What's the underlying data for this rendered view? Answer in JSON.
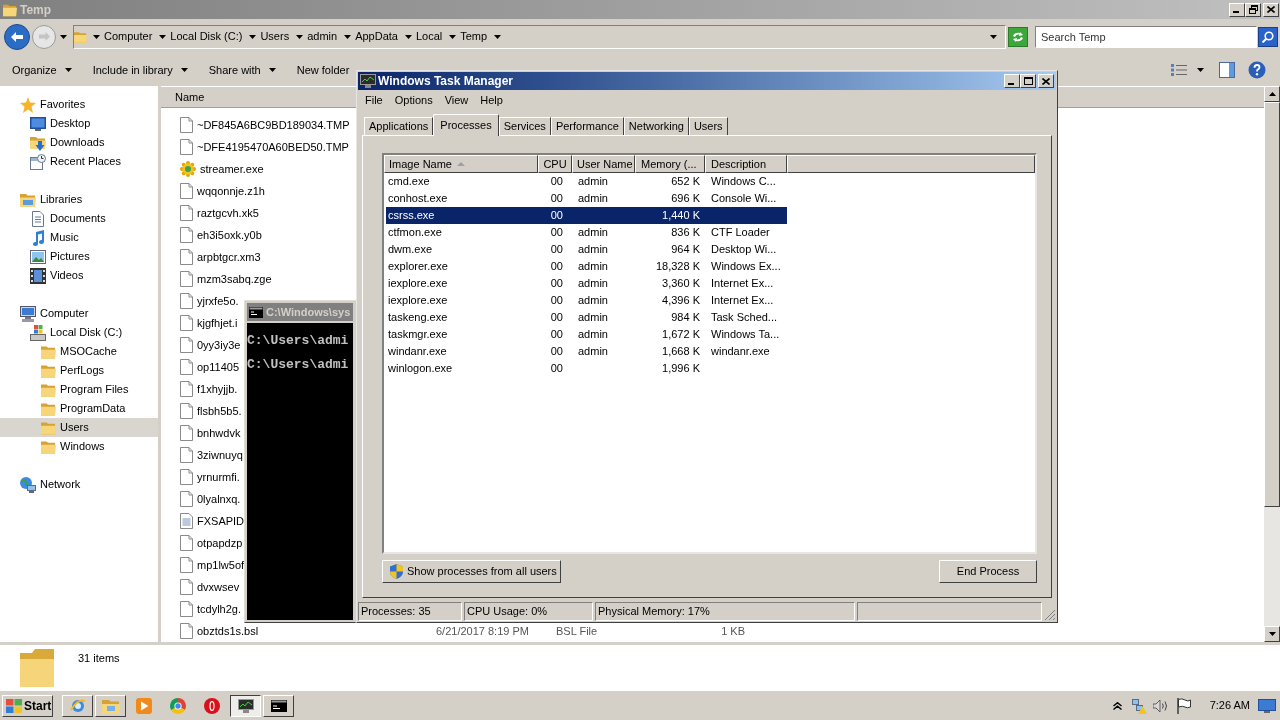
{
  "explorer": {
    "title": "Temp",
    "breadcrumb": [
      "Computer",
      "Local Disk (C:)",
      "Users",
      "admin",
      "AppData",
      "Local",
      "Temp"
    ],
    "search": {
      "placeholder": "Search Temp"
    },
    "toolbar": [
      {
        "label": "Organize",
        "kind": "menu"
      },
      {
        "label": "Include in library",
        "kind": "menu"
      },
      {
        "label": "Share with",
        "kind": "menu"
      },
      {
        "label": "New folder",
        "kind": "button"
      }
    ],
    "nav": [
      {
        "label": "Favorites",
        "selected": false,
        "children": [
          {
            "label": "Desktop",
            "selected": false
          },
          {
            "label": "Downloads",
            "selected": false
          },
          {
            "label": "Recent Places",
            "selected": false
          }
        ]
      },
      {
        "label": "Libraries",
        "selected": false,
        "children": [
          {
            "label": "Documents",
            "selected": false
          },
          {
            "label": "Music",
            "selected": false
          },
          {
            "label": "Pictures",
            "selected": false
          },
          {
            "label": "Videos",
            "selected": false
          }
        ]
      },
      {
        "label": "Computer",
        "selected": false,
        "children": [
          {
            "label": "Local Disk (C:)",
            "selected": false,
            "children": [
              {
                "label": "MSOCache",
                "selected": false
              },
              {
                "label": "PerfLogs",
                "selected": false
              },
              {
                "label": "Program Files",
                "selected": false
              },
              {
                "label": "ProgramData",
                "selected": false
              },
              {
                "label": "Users",
                "selected": true
              },
              {
                "label": "Windows",
                "selected": false
              }
            ]
          }
        ]
      },
      {
        "label": "Network",
        "selected": false
      }
    ],
    "columns": [
      "Name"
    ],
    "files": [
      {
        "name": "~DF845A6BC9BD189034.TMP",
        "kind": "file"
      },
      {
        "name": "~DFE4195470A60BED50.TMP",
        "kind": "file"
      },
      {
        "name": "streamer.exe",
        "kind": "exe"
      },
      {
        "name": "wqqonnje.z1h",
        "kind": "file"
      },
      {
        "name": "raztgcvh.xk5",
        "kind": "file"
      },
      {
        "name": "eh3i5oxk.y0b",
        "kind": "file"
      },
      {
        "name": "arpbtgcr.xm3",
        "kind": "file"
      },
      {
        "name": "mzm3sabq.zge",
        "kind": "file"
      },
      {
        "name": "yjrxfe5o.",
        "kind": "file"
      },
      {
        "name": "kjgfhjet.i",
        "kind": "file"
      },
      {
        "name": "0yy3iy3e",
        "kind": "file"
      },
      {
        "name": "op11405",
        "kind": "file"
      },
      {
        "name": "f1xhyjjb.",
        "kind": "file"
      },
      {
        "name": "flsbh5b5.",
        "kind": "file"
      },
      {
        "name": "bnhwdvk",
        "kind": "file"
      },
      {
        "name": "3ziwnuyq",
        "kind": "file"
      },
      {
        "name": "yrnurmfi.",
        "kind": "file"
      },
      {
        "name": "0lyalnxq.",
        "kind": "file"
      },
      {
        "name": "FXSAPID",
        "kind": "text"
      },
      {
        "name": "otpapdzp",
        "kind": "file"
      },
      {
        "name": "mp1lw5of",
        "kind": "file"
      },
      {
        "name": "dvxwsev",
        "kind": "file"
      },
      {
        "name": "tcdylh2g.",
        "kind": "file"
      },
      {
        "name": "obztds1s.bsl",
        "kind": "file",
        "date": "6/21/2017 8:19 PM",
        "type": "BSL File",
        "size": "1 KB"
      }
    ],
    "status": "31 items"
  },
  "cmd": {
    "title": "C:\\Windows\\sys",
    "lines": [
      "C:\\Users\\admi",
      "C:\\Users\\admi"
    ]
  },
  "task_manager": {
    "title": "Windows Task Manager",
    "menu": [
      "File",
      "Options",
      "View",
      "Help"
    ],
    "tabs": [
      {
        "label": "Applications",
        "selected": false
      },
      {
        "label": "Processes",
        "selected": true
      },
      {
        "label": "Services",
        "selected": false
      },
      {
        "label": "Performance",
        "selected": false
      },
      {
        "label": "Networking",
        "selected": false
      },
      {
        "label": "Users",
        "selected": false
      }
    ],
    "columns": [
      {
        "label": "Image Name",
        "sorted": true
      },
      {
        "label": "CPU",
        "sorted": false
      },
      {
        "label": "User Name",
        "sorted": false
      },
      {
        "label": "Memory (...",
        "sorted": false
      },
      {
        "label": "Description",
        "sorted": false
      }
    ],
    "processes": [
      {
        "image_name": "cmd.exe",
        "cpu": "00",
        "user_name": "admin",
        "memory": "652 K",
        "description": "Windows C...",
        "selected": false
      },
      {
        "image_name": "conhost.exe",
        "cpu": "00",
        "user_name": "admin",
        "memory": "696 K",
        "description": "Console Wi...",
        "selected": false
      },
      {
        "image_name": "csrss.exe",
        "cpu": "00",
        "memory": "1,440 K",
        "selected": true
      },
      {
        "image_name": "ctfmon.exe",
        "cpu": "00",
        "user_name": "admin",
        "memory": "836 K",
        "description": "CTF Loader",
        "selected": false
      },
      {
        "image_name": "dwm.exe",
        "cpu": "00",
        "user_name": "admin",
        "memory": "964 K",
        "description": "Desktop Wi...",
        "selected": false
      },
      {
        "image_name": "explorer.exe",
        "cpu": "00",
        "user_name": "admin",
        "memory": "18,328 K",
        "description": "Windows Ex...",
        "selected": false
      },
      {
        "image_name": "iexplore.exe",
        "cpu": "00",
        "user_name": "admin",
        "memory": "3,360 K",
        "description": "Internet Ex...",
        "selected": false
      },
      {
        "image_name": "iexplore.exe",
        "cpu": "00",
        "user_name": "admin",
        "memory": "4,396 K",
        "description": "Internet Ex...",
        "selected": false
      },
      {
        "image_name": "taskeng.exe",
        "cpu": "00",
        "user_name": "admin",
        "memory": "984 K",
        "description": "Task Sched...",
        "selected": false
      },
      {
        "image_name": "taskmgr.exe",
        "cpu": "00",
        "user_name": "admin",
        "memory": "1,672 K",
        "description": "Windows Ta...",
        "selected": false
      },
      {
        "image_name": "windanr.exe",
        "cpu": "00",
        "user_name": "admin",
        "memory": "1,668 K",
        "description": "windanr.exe",
        "selected": false
      },
      {
        "image_name": "winlogon.exe",
        "cpu": "00",
        "memory": "1,996 K",
        "selected": false
      }
    ],
    "show_all_button": "Show processes from all users",
    "end_button": "End Process",
    "status": [
      "Processes: 35",
      "CPU Usage: 0%",
      "Physical Memory: 17%"
    ]
  },
  "taskbar": {
    "start": "Start",
    "items": [
      {
        "running": true,
        "selected": false
      },
      {
        "running": true,
        "selected": false
      },
      {
        "running": false,
        "selected": false
      },
      {
        "running": false,
        "selected": false
      },
      {
        "running": false,
        "selected": false
      },
      {
        "running": true,
        "selected": true
      },
      {
        "running": true,
        "selected": false
      }
    ],
    "clock": "7:26 AM"
  }
}
